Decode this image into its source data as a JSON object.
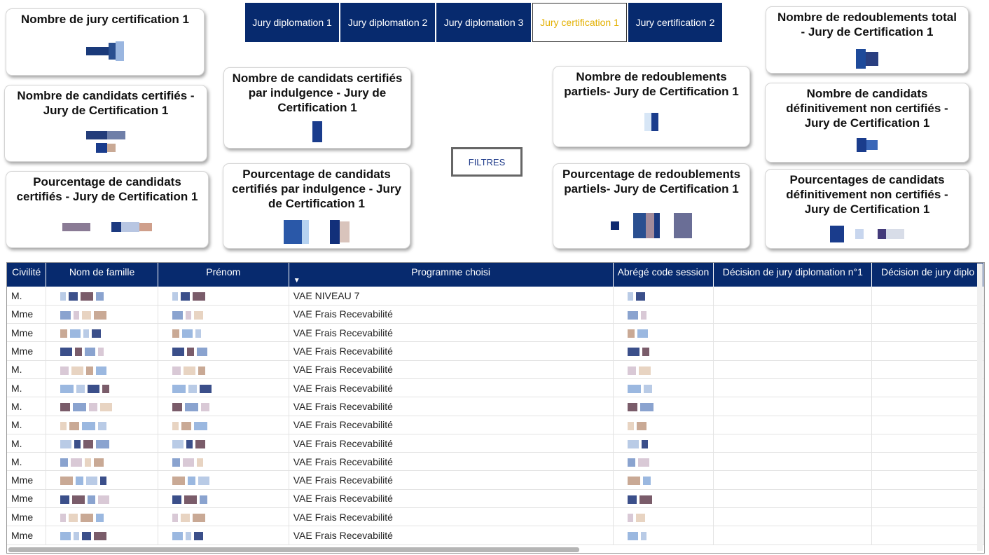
{
  "tabs": [
    {
      "label": "Jury diplomation 1",
      "active": false
    },
    {
      "label": "Jury diplomation 2",
      "active": false
    },
    {
      "label": "Jury diplomation 3",
      "active": false
    },
    {
      "label": "Jury certification 1",
      "active": true
    },
    {
      "label": "Jury certification 2",
      "active": false
    }
  ],
  "colors": {
    "navy": "#072a6e",
    "active_tab_text": "#e3b000",
    "filter_text": "#1e3a8a"
  },
  "filters_button": "FILTRES",
  "cards": {
    "nb_jury_certification": "Nombre de jury certification 1",
    "nb_candidats_certifies": "Nombre de candidats certifiés -\nJury de Certification 1",
    "pct_candidats_certifies": "Pourcentage de candidats\ncertifiés - Jury de Certification 1",
    "nb_certifies_indulgence": "Nombre de candidats certifiés\npar indulgence - Jury de\nCertification 1",
    "pct_certifies_indulgence": "Pourcentage de candidats\ncertifiés par indulgence - Jury\nde Certification 1",
    "nb_redoublements_partiels": "Nombre de redoublements\npartiels- Jury de Certification 1",
    "pct_redoublements_partiels": "Pourcentage de redoublements\npartiels- Jury de Certification 1",
    "nb_redoublements_total": "Nombre de redoublements total\n- Jury de Certification 1",
    "nb_definitivement_non_certifies": "Nombre de candidats\ndéfinitivement non certifiés -\nJury de Certification 1",
    "pct_definitivement_non_certifies": "Pourcentages de candidats\ndéfinitivement non certifiés -\nJury de Certification 1"
  },
  "table": {
    "columns": [
      "Civilité",
      "Nom de famille",
      "Prénom",
      "Programme choisi",
      "Abrégé code session",
      "Décision de jury diplomation n°1",
      "Décision de jury diplo"
    ],
    "rows": [
      {
        "civilite": "M.",
        "programme": "VAE NIVEAU 7"
      },
      {
        "civilite": "Mme",
        "programme": "VAE Frais Recevabilité"
      },
      {
        "civilite": "Mme",
        "programme": "VAE Frais Recevabilité"
      },
      {
        "civilite": "Mme",
        "programme": "VAE Frais Recevabilité"
      },
      {
        "civilite": "M.",
        "programme": "VAE Frais Recevabilité"
      },
      {
        "civilite": "M.",
        "programme": "VAE Frais Recevabilité"
      },
      {
        "civilite": "M.",
        "programme": "VAE Frais Recevabilité"
      },
      {
        "civilite": "M.",
        "programme": "VAE Frais Recevabilité"
      },
      {
        "civilite": "M.",
        "programme": "VAE Frais Recevabilité"
      },
      {
        "civilite": "M.",
        "programme": "VAE Frais Recevabilité"
      },
      {
        "civilite": "Mme",
        "programme": "VAE Frais Recevabilité"
      },
      {
        "civilite": "Mme",
        "programme": "VAE Frais Recevabilité"
      },
      {
        "civilite": "Mme",
        "programme": "VAE Frais Recevabilité"
      },
      {
        "civilite": "Mme",
        "programme": "VAE Frais Recevabilité"
      }
    ]
  }
}
